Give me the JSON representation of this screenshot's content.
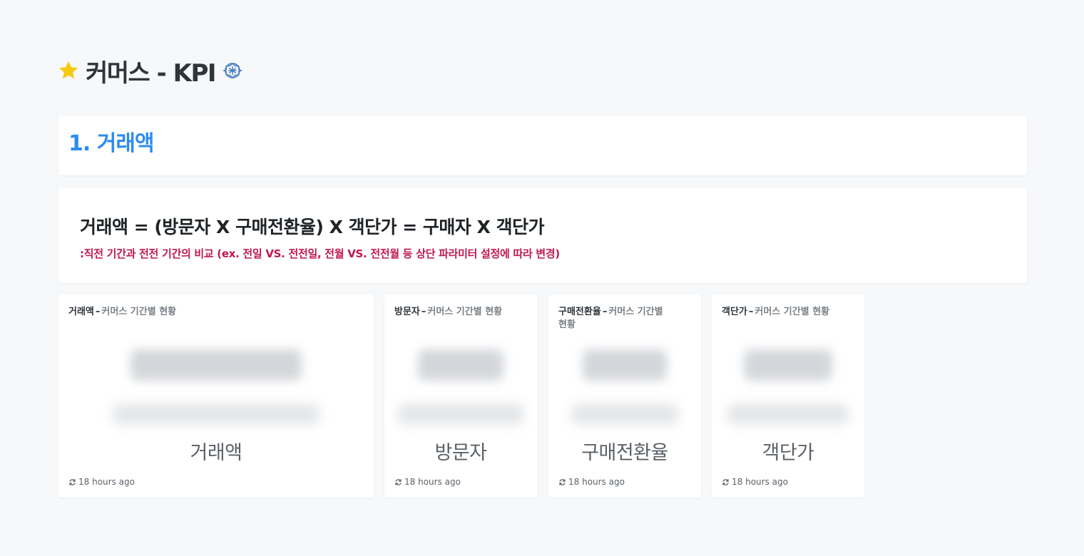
{
  "dashboard": {
    "title": "커머스 - KPI",
    "star_icon": "star-icon",
    "verified_icon": "verified-badge-icon",
    "accent_color": "#2d8cf0"
  },
  "section": {
    "heading": "1. 거래액"
  },
  "formula": {
    "text": "거래액 = (방문자 X 구매전환율) X 객단가 = 구매자 X 객단가",
    "note": ":직전 기간과 전전 기간의 비교 (ex. 전일 VS. 전전일, 전월 VS. 전전월 등 상단 파라미터 설정에 따라 변경)",
    "note_color": "#c0184f"
  },
  "kpis": [
    {
      "metric": "거래액",
      "separator": "–",
      "subtitle": "커머스 기간별 현황",
      "label": "거래액",
      "updated": "18 hours ago"
    },
    {
      "metric": "방문자",
      "separator": "–",
      "subtitle": "커머스 기간별 현황",
      "label": "방문자",
      "updated": "18 hours ago"
    },
    {
      "metric": "구매전환율",
      "separator": "–",
      "subtitle": "커머스 기간별 현황",
      "label": "구매전환율",
      "updated": "18 hours ago"
    },
    {
      "metric": "객단가",
      "separator": "–",
      "subtitle": "커머스 기간별 현황",
      "label": "객단가",
      "updated": "18 hours ago"
    }
  ]
}
